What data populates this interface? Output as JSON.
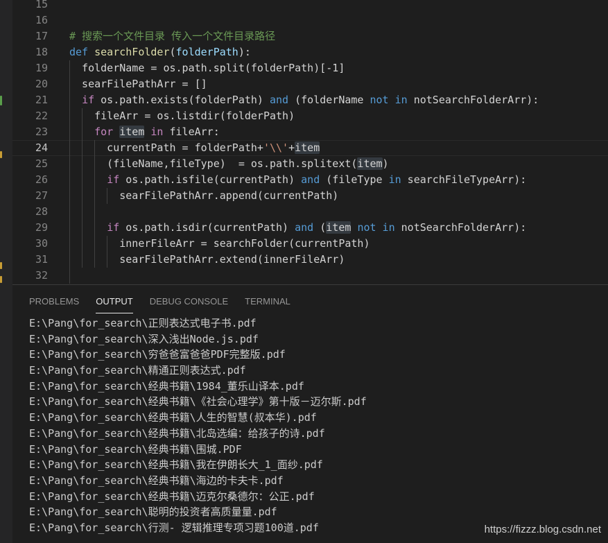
{
  "editor": {
    "active_line": "24",
    "lines": [
      {
        "n": "15",
        "tokens": []
      },
      {
        "n": "16",
        "tokens": []
      },
      {
        "n": "17",
        "tokens": [
          {
            "t": "# 搜索一个文件目录 传入一个文件目录路径",
            "c": "comment"
          }
        ]
      },
      {
        "n": "18",
        "tokens": [
          {
            "t": "def ",
            "c": "kw"
          },
          {
            "t": "searchFolder",
            "c": "fn"
          },
          {
            "t": "(",
            "c": "plain"
          },
          {
            "t": "folderPath",
            "c": "var"
          },
          {
            "t": "):",
            "c": "plain"
          }
        ]
      },
      {
        "n": "19",
        "tokens": [
          {
            "t": "  folderName = os.path.split(folderPath)[-1]",
            "c": "plain"
          }
        ]
      },
      {
        "n": "20",
        "tokens": [
          {
            "t": "  searFilePathArr = []",
            "c": "plain"
          }
        ]
      },
      {
        "n": "21",
        "tokens": [
          {
            "t": "  ",
            "c": "plain"
          },
          {
            "t": "if",
            "c": "ctl"
          },
          {
            "t": " os.path.exists(folderPath) ",
            "c": "plain"
          },
          {
            "t": "and",
            "c": "kw"
          },
          {
            "t": " (folderName ",
            "c": "plain"
          },
          {
            "t": "not in",
            "c": "kw"
          },
          {
            "t": " notSearchFolderArr):",
            "c": "plain"
          }
        ]
      },
      {
        "n": "22",
        "tokens": [
          {
            "t": "    fileArr = os.listdir(folderPath)",
            "c": "plain"
          }
        ]
      },
      {
        "n": "23",
        "tokens": [
          {
            "t": "    ",
            "c": "plain"
          },
          {
            "t": "for",
            "c": "ctl"
          },
          {
            "t": " ",
            "c": "plain"
          },
          {
            "t": "item",
            "c": "plain",
            "h": true
          },
          {
            "t": " ",
            "c": "plain"
          },
          {
            "t": "in",
            "c": "ctl"
          },
          {
            "t": " fileArr:",
            "c": "plain"
          }
        ]
      },
      {
        "n": "24",
        "tokens": [
          {
            "t": "      currentPath = folderPath+",
            "c": "plain"
          },
          {
            "t": "'\\\\'",
            "c": "str"
          },
          {
            "t": "+",
            "c": "plain"
          },
          {
            "t": "item",
            "c": "plain",
            "h": true
          }
        ]
      },
      {
        "n": "25",
        "tokens": [
          {
            "t": "      (fileName,fileType)  = os.path.splitext(",
            "c": "plain"
          },
          {
            "t": "item",
            "c": "plain",
            "h": true
          },
          {
            "t": ")",
            "c": "plain"
          }
        ]
      },
      {
        "n": "26",
        "tokens": [
          {
            "t": "      ",
            "c": "plain"
          },
          {
            "t": "if",
            "c": "ctl"
          },
          {
            "t": " os.path.isfile(currentPath) ",
            "c": "plain"
          },
          {
            "t": "and",
            "c": "kw"
          },
          {
            "t": " (fileType ",
            "c": "plain"
          },
          {
            "t": "in",
            "c": "kw"
          },
          {
            "t": " searchFileTypeArr):",
            "c": "plain"
          }
        ]
      },
      {
        "n": "27",
        "tokens": [
          {
            "t": "        searFilePathArr.append(currentPath)",
            "c": "plain"
          }
        ]
      },
      {
        "n": "28",
        "tokens": []
      },
      {
        "n": "29",
        "tokens": [
          {
            "t": "      ",
            "c": "plain"
          },
          {
            "t": "if",
            "c": "ctl"
          },
          {
            "t": " os.path.isdir(currentPath) ",
            "c": "plain"
          },
          {
            "t": "and",
            "c": "kw"
          },
          {
            "t": " (",
            "c": "plain"
          },
          {
            "t": "item",
            "c": "plain",
            "h": true
          },
          {
            "t": " ",
            "c": "plain"
          },
          {
            "t": "not in",
            "c": "kw"
          },
          {
            "t": " notSearchFolderArr):",
            "c": "plain"
          }
        ]
      },
      {
        "n": "30",
        "tokens": [
          {
            "t": "        innerFileArr = searchFolder(currentPath)",
            "c": "plain"
          }
        ]
      },
      {
        "n": "31",
        "tokens": [
          {
            "t": "        searFilePathArr.extend(innerFileArr)",
            "c": "plain"
          }
        ]
      },
      {
        "n": "32",
        "tokens": []
      }
    ]
  },
  "panel": {
    "tabs": [
      {
        "label": "PROBLEMS",
        "active": false
      },
      {
        "label": "OUTPUT",
        "active": true
      },
      {
        "label": "DEBUG CONSOLE",
        "active": false
      },
      {
        "label": "TERMINAL",
        "active": false
      }
    ],
    "output_lines": [
      "E:\\Pang\\for_search\\正则表达式电子书.pdf",
      "E:\\Pang\\for_search\\深入浅出Node.js.pdf",
      "E:\\Pang\\for_search\\穷爸爸富爸爸PDF完整版.pdf",
      "E:\\Pang\\for_search\\精通正则表达式.pdf",
      "E:\\Pang\\for_search\\经典书籍\\1984_董乐山译本.pdf",
      "E:\\Pang\\for_search\\经典书籍\\《社会心理学》第十版－迈尔斯.pdf",
      "E:\\Pang\\for_search\\经典书籍\\人生的智慧(叔本华).pdf",
      "E:\\Pang\\for_search\\经典书籍\\北岛选编：给孩子的诗.pdf",
      "E:\\Pang\\for_search\\经典书籍\\围城.PDF",
      "E:\\Pang\\for_search\\经典书籍\\我在伊朗长大_1_面纱.pdf",
      "E:\\Pang\\for_search\\经典书籍\\海边的卡夫卡.pdf",
      "E:\\Pang\\for_search\\经典书籍\\迈克尔桑德尔：公正.pdf",
      "E:\\Pang\\for_search\\聪明的投资者高质量量.pdf",
      "E:\\Pang\\for_search\\行测- 逻辑推理专项习题100道.pdf"
    ]
  },
  "watermark": "https://fizzz.blog.csdn.net",
  "colors": {
    "background": "#1e1e1e",
    "comment": "#6a9955",
    "keyword": "#569cd6",
    "control": "#c586c0",
    "function": "#dcdcaa",
    "parameter": "#9cdcfe",
    "string": "#ce9178",
    "text": "#d4d4d4"
  }
}
